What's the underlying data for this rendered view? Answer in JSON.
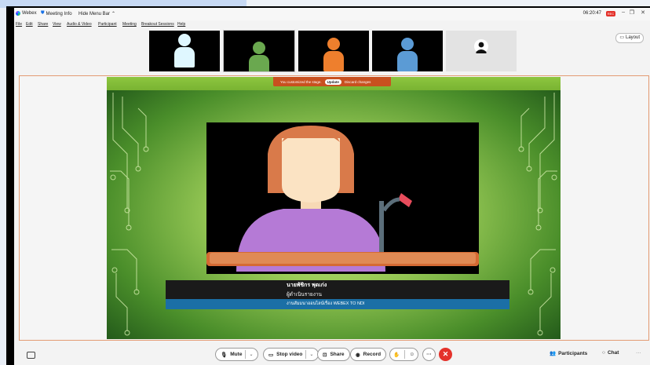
{
  "app": {
    "name": "Webex",
    "meeting_info": "Meeting Info",
    "hide_menu_bar": "Hide Menu Bar",
    "time": "06:20:47",
    "rec_badge": "REC"
  },
  "menu": [
    "File",
    "Edit",
    "Share",
    "View",
    "Audio & Video",
    "Participant",
    "Meeting",
    "Breakout Sessions",
    "Help"
  ],
  "thumbnails": [
    {
      "head_color": "#dff7ff",
      "body_color": "#dff7ff"
    },
    {
      "head_color": "#6aa84f",
      "body_color": "#6aa84f"
    },
    {
      "head_color": "#ee7f2d",
      "body_color": "#ee7f2d"
    },
    {
      "head_color": "#5b9bd5",
      "body_color": "#5b9bd5"
    },
    {
      "icon": "avatar-icon"
    }
  ],
  "layout_button": "Layout",
  "stage_notice": {
    "text": "You customized the stage.",
    "update": "Update",
    "discard": "Discard changes"
  },
  "caption": {
    "name": "นายพัชิกร พุดเก่ง",
    "role": "ผู้ดำเนินรายงาน",
    "subtitle": "งานสัมมนาออนไลน์เรื่อง WEBEX TO NDI"
  },
  "controls": {
    "mute": "Mute",
    "stop_video": "Stop video",
    "share": "Share",
    "record": "Record",
    "participants": "Participants",
    "chat": "Chat"
  },
  "colors": {
    "accent_orange": "#c8501f",
    "end_red": "#e4322b",
    "caption_blue": "#1b6fa6",
    "presenter_shirt": "#b57ad6",
    "presenter_hair": "#d97a4a"
  }
}
